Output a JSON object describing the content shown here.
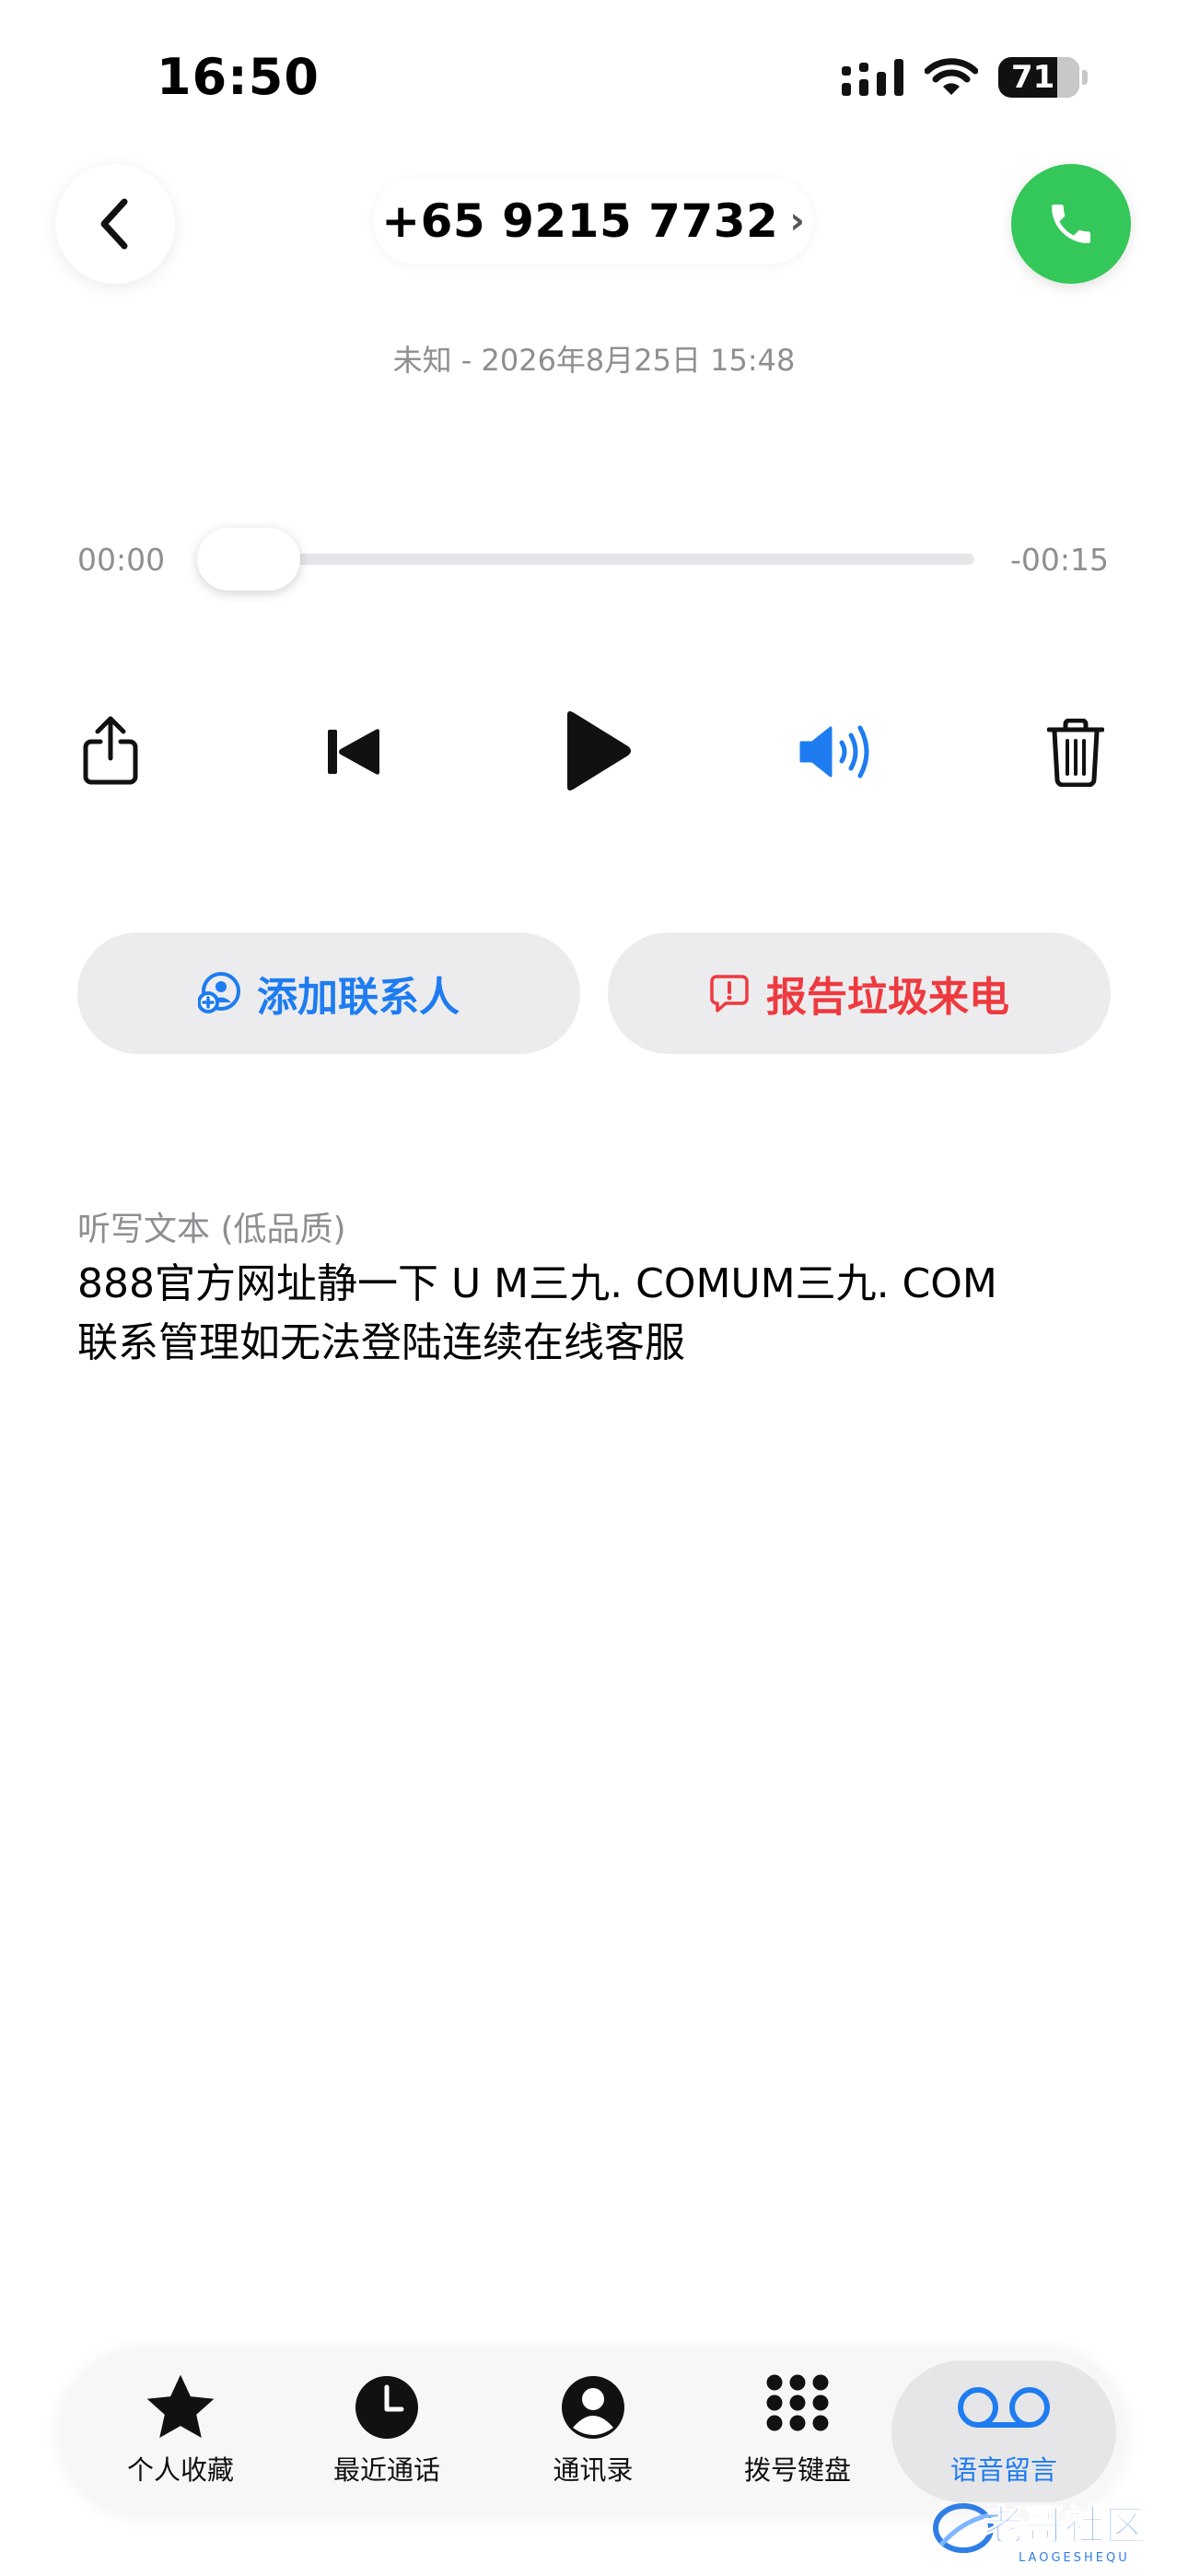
{
  "status_bar": {
    "time": "16:50",
    "battery": "71"
  },
  "header": {
    "phone_number": "+65 9215 7732",
    "chevron": "›"
  },
  "subtitle": "未知 - 2026年8月25日 15:48",
  "player": {
    "elapsed": "00:00",
    "remaining": "-00:15",
    "progress": 0.0
  },
  "actions": {
    "add_contact": "添加联系人",
    "report_spam": "报告垃圾来电"
  },
  "transcript": {
    "label": "听写文本 (低品质)",
    "lines": [
      "888官方网址静一下 U M三九. COMUM三九. COM",
      "联系管理如无法登陆连续在线客服"
    ]
  },
  "tabs": [
    {
      "label": "个人收藏",
      "icon": "star-icon"
    },
    {
      "label": "最近通话",
      "icon": "clock-icon"
    },
    {
      "label": "通讯录",
      "icon": "person-circle-icon"
    },
    {
      "label": "拨号键盘",
      "icon": "keypad-icon"
    },
    {
      "label": "语音留言",
      "icon": "voicemail-icon",
      "active": true
    }
  ],
  "watermark": {
    "text": "老哥社区",
    "sub": "LAOGESHEQU"
  },
  "colors": {
    "accent": "#1e7cf0",
    "danger": "#ee3a3f",
    "call_green": "#34c759"
  }
}
